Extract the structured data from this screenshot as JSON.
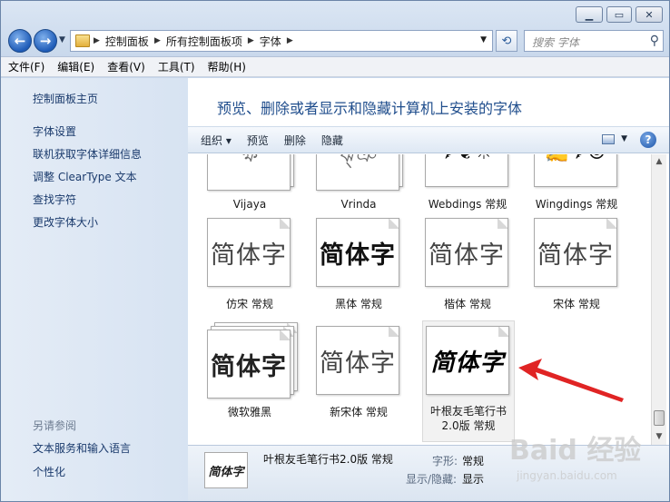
{
  "window": {
    "title_buttons": [
      "minimize",
      "maximize",
      "close"
    ]
  },
  "address": {
    "crumbs": [
      "控制面板",
      "所有控制面板项",
      "字体"
    ],
    "search_placeholder": "搜索 字体"
  },
  "menu": [
    "文件(F)",
    "编辑(E)",
    "查看(V)",
    "工具(T)",
    "帮助(H)"
  ],
  "sidebar": {
    "home_link": "控制面板主页",
    "links": [
      "字体设置",
      "联机获取字体详细信息",
      "调整 ClearType 文本",
      "查找字符",
      "更改字体大小"
    ],
    "see_also_heading": "另请参阅",
    "see_also": [
      "文本服务和输入语言",
      "个性化"
    ]
  },
  "main": {
    "heading": "预览、删除或者显示和隐藏计算机上安装的字体",
    "toolbar": [
      "组织",
      "预览",
      "删除",
      "隐藏"
    ],
    "fonts": [
      {
        "label": "Vijaya",
        "sample": "ক্ষ"
      },
      {
        "label": "Vrinda",
        "sample": "ঝ্ঞ"
      },
      {
        "label": "Webdings 常规",
        "sample": "✈❦☀"
      },
      {
        "label": "Wingdings 常规",
        "sample": "✍✈☺"
      },
      {
        "label": "仿宋 常规",
        "sample": "简体字"
      },
      {
        "label": "黑体 常规",
        "sample": "简体字"
      },
      {
        "label": "楷体 常规",
        "sample": "简体字"
      },
      {
        "label": "宋体 常规",
        "sample": "简体字"
      },
      {
        "label": "微软雅黑",
        "sample": "简体字"
      },
      {
        "label": "新宋体 常规",
        "sample": "简体字"
      },
      {
        "label": "叶根友毛笔行书 2.0版 常规",
        "sample": "简体字"
      }
    ]
  },
  "details": {
    "name": "叶根友毛笔行书2.0版 常规",
    "thumb_sample": "简体字",
    "style_key": "字形:",
    "style_value": "常规",
    "visibility_key": "显示/隐藏:",
    "visibility_value": "显示"
  },
  "watermark": {
    "main": "Baid 经验",
    "sub": "jingyan.baidu.com"
  },
  "colors": {
    "heading": "#1f4d8c",
    "link": "#1a3a6c",
    "arrow": "#e02424"
  }
}
